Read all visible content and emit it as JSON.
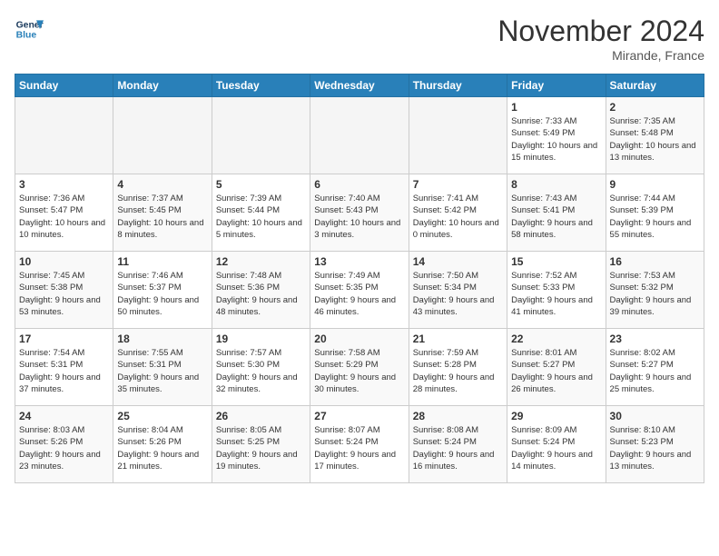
{
  "header": {
    "logo_line1": "General",
    "logo_line2": "Blue",
    "month": "November 2024",
    "location": "Mirande, France"
  },
  "days_of_week": [
    "Sunday",
    "Monday",
    "Tuesday",
    "Wednesday",
    "Thursday",
    "Friday",
    "Saturday"
  ],
  "weeks": [
    [
      {
        "num": "",
        "info": "",
        "empty": true
      },
      {
        "num": "",
        "info": "",
        "empty": true
      },
      {
        "num": "",
        "info": "",
        "empty": true
      },
      {
        "num": "",
        "info": "",
        "empty": true
      },
      {
        "num": "",
        "info": "",
        "empty": true
      },
      {
        "num": "1",
        "info": "Sunrise: 7:33 AM\nSunset: 5:49 PM\nDaylight: 10 hours and 15 minutes.",
        "empty": false
      },
      {
        "num": "2",
        "info": "Sunrise: 7:35 AM\nSunset: 5:48 PM\nDaylight: 10 hours and 13 minutes.",
        "empty": false
      }
    ],
    [
      {
        "num": "3",
        "info": "Sunrise: 7:36 AM\nSunset: 5:47 PM\nDaylight: 10 hours and 10 minutes.",
        "empty": false
      },
      {
        "num": "4",
        "info": "Sunrise: 7:37 AM\nSunset: 5:45 PM\nDaylight: 10 hours and 8 minutes.",
        "empty": false
      },
      {
        "num": "5",
        "info": "Sunrise: 7:39 AM\nSunset: 5:44 PM\nDaylight: 10 hours and 5 minutes.",
        "empty": false
      },
      {
        "num": "6",
        "info": "Sunrise: 7:40 AM\nSunset: 5:43 PM\nDaylight: 10 hours and 3 minutes.",
        "empty": false
      },
      {
        "num": "7",
        "info": "Sunrise: 7:41 AM\nSunset: 5:42 PM\nDaylight: 10 hours and 0 minutes.",
        "empty": false
      },
      {
        "num": "8",
        "info": "Sunrise: 7:43 AM\nSunset: 5:41 PM\nDaylight: 9 hours and 58 minutes.",
        "empty": false
      },
      {
        "num": "9",
        "info": "Sunrise: 7:44 AM\nSunset: 5:39 PM\nDaylight: 9 hours and 55 minutes.",
        "empty": false
      }
    ],
    [
      {
        "num": "10",
        "info": "Sunrise: 7:45 AM\nSunset: 5:38 PM\nDaylight: 9 hours and 53 minutes.",
        "empty": false
      },
      {
        "num": "11",
        "info": "Sunrise: 7:46 AM\nSunset: 5:37 PM\nDaylight: 9 hours and 50 minutes.",
        "empty": false
      },
      {
        "num": "12",
        "info": "Sunrise: 7:48 AM\nSunset: 5:36 PM\nDaylight: 9 hours and 48 minutes.",
        "empty": false
      },
      {
        "num": "13",
        "info": "Sunrise: 7:49 AM\nSunset: 5:35 PM\nDaylight: 9 hours and 46 minutes.",
        "empty": false
      },
      {
        "num": "14",
        "info": "Sunrise: 7:50 AM\nSunset: 5:34 PM\nDaylight: 9 hours and 43 minutes.",
        "empty": false
      },
      {
        "num": "15",
        "info": "Sunrise: 7:52 AM\nSunset: 5:33 PM\nDaylight: 9 hours and 41 minutes.",
        "empty": false
      },
      {
        "num": "16",
        "info": "Sunrise: 7:53 AM\nSunset: 5:32 PM\nDaylight: 9 hours and 39 minutes.",
        "empty": false
      }
    ],
    [
      {
        "num": "17",
        "info": "Sunrise: 7:54 AM\nSunset: 5:31 PM\nDaylight: 9 hours and 37 minutes.",
        "empty": false
      },
      {
        "num": "18",
        "info": "Sunrise: 7:55 AM\nSunset: 5:31 PM\nDaylight: 9 hours and 35 minutes.",
        "empty": false
      },
      {
        "num": "19",
        "info": "Sunrise: 7:57 AM\nSunset: 5:30 PM\nDaylight: 9 hours and 32 minutes.",
        "empty": false
      },
      {
        "num": "20",
        "info": "Sunrise: 7:58 AM\nSunset: 5:29 PM\nDaylight: 9 hours and 30 minutes.",
        "empty": false
      },
      {
        "num": "21",
        "info": "Sunrise: 7:59 AM\nSunset: 5:28 PM\nDaylight: 9 hours and 28 minutes.",
        "empty": false
      },
      {
        "num": "22",
        "info": "Sunrise: 8:01 AM\nSunset: 5:27 PM\nDaylight: 9 hours and 26 minutes.",
        "empty": false
      },
      {
        "num": "23",
        "info": "Sunrise: 8:02 AM\nSunset: 5:27 PM\nDaylight: 9 hours and 25 minutes.",
        "empty": false
      }
    ],
    [
      {
        "num": "24",
        "info": "Sunrise: 8:03 AM\nSunset: 5:26 PM\nDaylight: 9 hours and 23 minutes.",
        "empty": false
      },
      {
        "num": "25",
        "info": "Sunrise: 8:04 AM\nSunset: 5:26 PM\nDaylight: 9 hours and 21 minutes.",
        "empty": false
      },
      {
        "num": "26",
        "info": "Sunrise: 8:05 AM\nSunset: 5:25 PM\nDaylight: 9 hours and 19 minutes.",
        "empty": false
      },
      {
        "num": "27",
        "info": "Sunrise: 8:07 AM\nSunset: 5:24 PM\nDaylight: 9 hours and 17 minutes.",
        "empty": false
      },
      {
        "num": "28",
        "info": "Sunrise: 8:08 AM\nSunset: 5:24 PM\nDaylight: 9 hours and 16 minutes.",
        "empty": false
      },
      {
        "num": "29",
        "info": "Sunrise: 8:09 AM\nSunset: 5:24 PM\nDaylight: 9 hours and 14 minutes.",
        "empty": false
      },
      {
        "num": "30",
        "info": "Sunrise: 8:10 AM\nSunset: 5:23 PM\nDaylight: 9 hours and 13 minutes.",
        "empty": false
      }
    ]
  ]
}
